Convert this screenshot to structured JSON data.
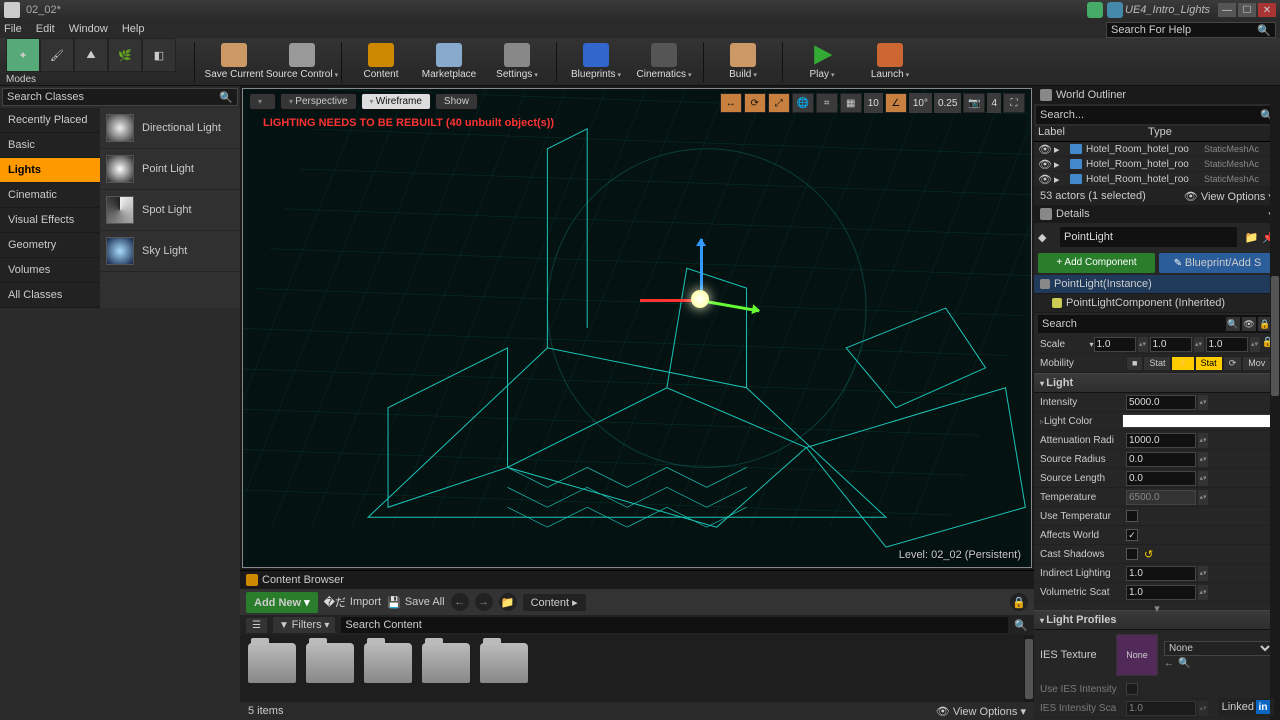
{
  "titlebar": {
    "doc": "02_02*",
    "project": "UE4_Intro_Lights"
  },
  "menu": {
    "file": "File",
    "edit": "Edit",
    "window": "Window",
    "help": "Help"
  },
  "topsearch": {
    "placeholder": "Search For Help"
  },
  "toolbar": {
    "modes": "Modes",
    "save": "Save Current",
    "source": "Source Control",
    "content": "Content",
    "market": "Marketplace",
    "settings": "Settings",
    "blueprints": "Blueprints",
    "cine": "Cinematics",
    "build": "Build",
    "play": "Play",
    "launch": "Launch"
  },
  "placer": {
    "search": "Search Classes",
    "cats": [
      "Recently Placed",
      "Basic",
      "Lights",
      "Cinematic",
      "Visual Effects",
      "Geometry",
      "Volumes",
      "All Classes"
    ],
    "active": "Lights",
    "lights": [
      "Directional Light",
      "Point Light",
      "Spot Light",
      "Sky Light"
    ]
  },
  "viewport": {
    "perspective": "Perspective",
    "wireframe": "Wireframe",
    "show": "Show",
    "warn": "LIGHTING NEEDS TO BE REBUILT (40 unbuilt object(s))",
    "snap_t": "10",
    "snap_r": "10°",
    "snap_s": "0.25",
    "cam": "4",
    "level": "Level: 02_02 (Persistent)"
  },
  "cb": {
    "title": "Content Browser",
    "addnew": "Add New",
    "import": "Import",
    "saveall": "Save All",
    "path": "Content",
    "filters": "Filters",
    "search": "Search Content",
    "items": "5 items",
    "viewopts": "View Options"
  },
  "outliner": {
    "title": "World Outliner",
    "search": "Search...",
    "label": "Label",
    "type": "Type",
    "rows": [
      {
        "n": "Hotel_Room_hotel_roo",
        "t": "StaticMeshAc"
      },
      {
        "n": "Hotel_Room_hotel_roo",
        "t": "StaticMeshAc"
      },
      {
        "n": "Hotel_Room_hotel_roo",
        "t": "StaticMeshAc"
      }
    ],
    "status": "53 actors (1 selected)",
    "viewopts": "View Options"
  },
  "details": {
    "title": "Details",
    "name": "PointLight",
    "addcomp": "+ Add Component",
    "bpadd": "Blueprint/Add S",
    "comp_root": "PointLight(Instance)",
    "comp_child": "PointLightComponent (Inherited)",
    "search": "Search",
    "scale": "Scale",
    "scale_x": "1.0",
    "scale_y": "1.0",
    "scale_z": "1.0",
    "mobility": "Mobility",
    "mob_stat": "Stat",
    "mob_stat2": "Stat",
    "mob_mov": "Mov",
    "cat_light": "Light",
    "intensity": "Intensity",
    "intensity_v": "5000.0",
    "lightcolor": "Light Color",
    "atten": "Attenuation Radi",
    "atten_v": "1000.0",
    "srcr": "Source Radius",
    "srcr_v": "0.0",
    "srcl": "Source Length",
    "srcl_v": "0.0",
    "temp": "Temperature",
    "temp_v": "6500.0",
    "usetemp": "Use Temperatur",
    "affects": "Affects World",
    "shadows": "Cast Shadows",
    "indirect": "Indirect Lighting",
    "indirect_v": "1.0",
    "volum": "Volumetric Scat",
    "volum_v": "1.0",
    "cat_profiles": "Light Profiles",
    "ies": "IES Texture",
    "ies_none": "None",
    "ies_sel": "None",
    "iesint": "Use IES Intensity",
    "iesintsc": "IES Intensity Sca",
    "iesintsc_v": "1.0"
  },
  "linkedin": "Linked"
}
